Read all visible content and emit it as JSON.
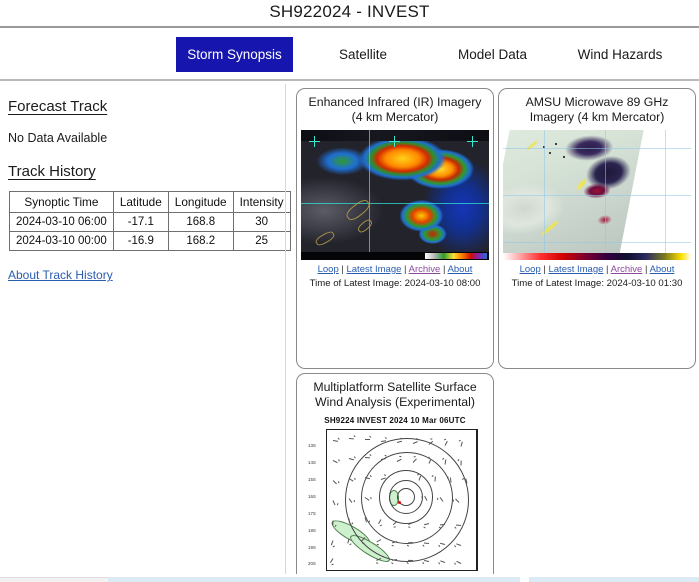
{
  "header": {
    "title": "SH922024 - INVEST"
  },
  "tabs": [
    {
      "label": "Storm Synopsis",
      "active": true
    },
    {
      "label": "Satellite",
      "active": false
    },
    {
      "label": "Model Data",
      "active": false
    },
    {
      "label": "Wind Hazards",
      "active": false
    }
  ],
  "sidebar": {
    "forecast_track_heading": "Forecast Track",
    "forecast_track_status": "No Data Available",
    "track_history_heading": "Track History",
    "table": {
      "columns": [
        "Synoptic Time",
        "Latitude",
        "Longitude",
        "Intensity"
      ],
      "rows": [
        [
          "2024-03-10 06:00",
          "-17.1",
          "168.8",
          "30"
        ],
        [
          "2024-03-10 00:00",
          "-16.9",
          "168.2",
          "25"
        ]
      ]
    },
    "about_link": "About Track History"
  },
  "panels": {
    "ir": {
      "title": "Enhanced Infrared (IR) Imagery (4 km Mercator)",
      "links": {
        "loop": "Loop",
        "latest": "Latest Image",
        "archive": "Archive",
        "about": "About",
        "separator": "|"
      },
      "time_label": "Time of Latest Image: 2024-03-10 08:00"
    },
    "amsu": {
      "title": "AMSU Microwave 89 GHz Imagery (4 km Mercator)",
      "links": {
        "loop": "Loop",
        "latest": "Latest Image",
        "archive": "Archive",
        "about": "About",
        "separator": "|"
      },
      "time_label": "Time of Latest Image: 2024-03-10 01:30"
    },
    "multiplatform": {
      "title": "Multiplatform Satellite Surface Wind Analysis (Experimental)",
      "subtitle": "SH9224     INVEST     2024 10 Mar 06UTC",
      "y_ticks": [
        "13S",
        "14S",
        "15S",
        "16S",
        "17S",
        "18S",
        "19S",
        "20S"
      ]
    }
  },
  "colors": {
    "active_tab_bg": "#1616ae",
    "active_tab_text": "#ffffff",
    "link_blue": "#2a5db0",
    "link_visited": "#8b4a9c",
    "panel_border": "#8a8a8a",
    "text": "#1b1b1b"
  }
}
